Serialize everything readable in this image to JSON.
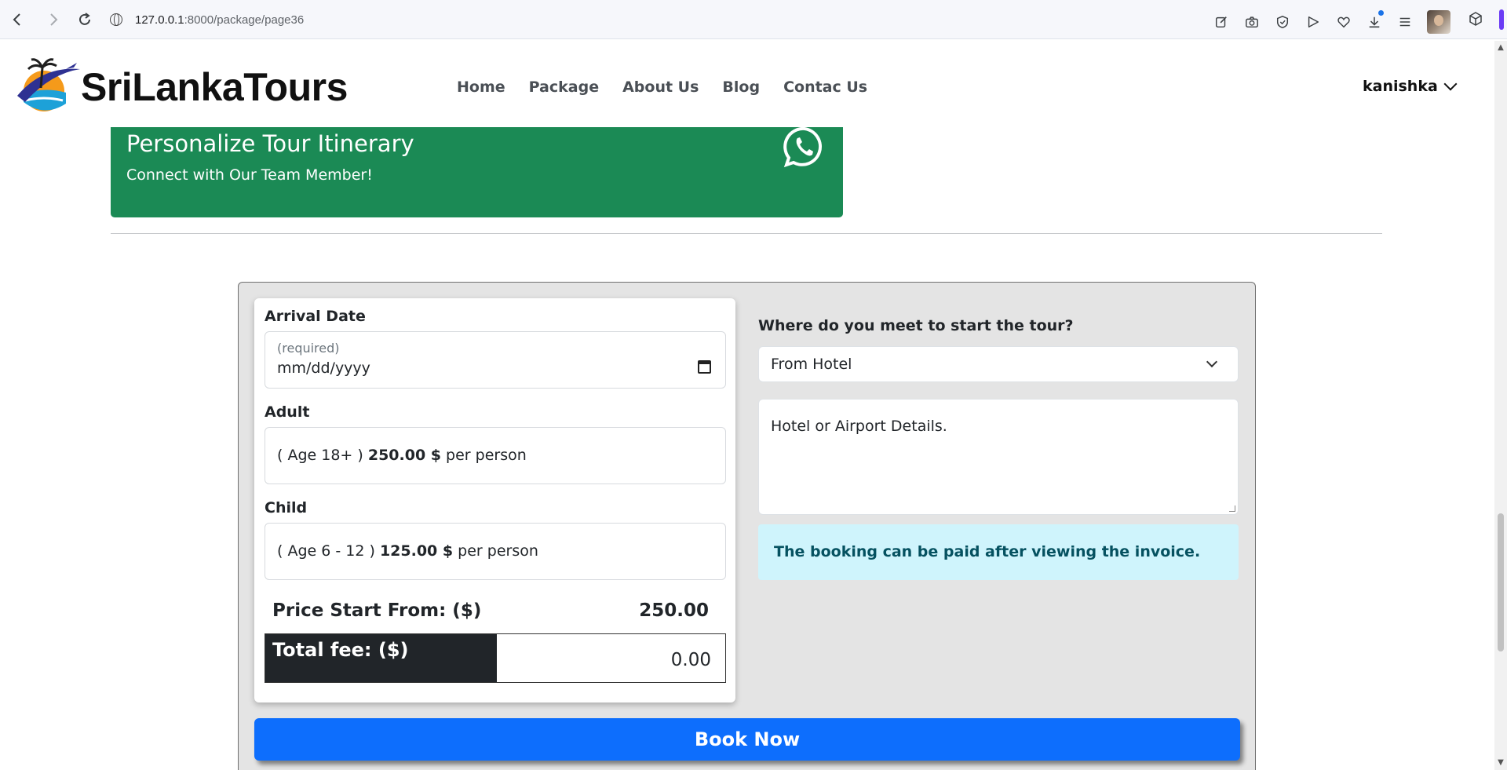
{
  "browser": {
    "url_host": "127.0.0.1",
    "url_path": ":8000/package/page36",
    "icons": [
      "back-icon",
      "forward-icon",
      "reload-icon",
      "site-info-icon",
      "edit-icon",
      "camera-icon",
      "shield-icon",
      "send-icon",
      "heart-icon",
      "download-icon",
      "menu-icon",
      "profile-avatar",
      "extension-icon"
    ]
  },
  "header": {
    "brand": "SriLankaTours",
    "nav": [
      "Home",
      "Package",
      "About Us",
      "Blog",
      "Contac Us"
    ],
    "user": "kanishka"
  },
  "banner": {
    "title": "Personalize Tour Itinerary",
    "subtitle": "Connect with Our Team Member!",
    "color": "#1b8a55"
  },
  "booking": {
    "arrival_label": "Arrival Date",
    "arrival_hint": "(required)",
    "arrival_placeholder": "mm/dd/yyyy",
    "adult_label": "Adult",
    "adult_age": "( Age 18+ )",
    "adult_price": "250.00 $",
    "adult_suffix": "per person",
    "child_label": "Child",
    "child_age": "( Age 6 - 12 )",
    "child_price": "125.00 $",
    "child_suffix": "per person",
    "price_start_label": "Price Start From: ($)",
    "price_start_value": "250.00",
    "total_label": "Total fee: ($)",
    "total_value": "0.00",
    "meet_label": "Where do you meet to start the tour?",
    "meet_selected": "From Hotel",
    "details_placeholder": "Hotel or Airport Details.",
    "info_text": "The booking can be paid after viewing the invoice.",
    "book_button": "Book Now",
    "colors": {
      "primary": "#0d6efd",
      "info_bg": "#cff4fc",
      "dark": "#212529"
    }
  }
}
